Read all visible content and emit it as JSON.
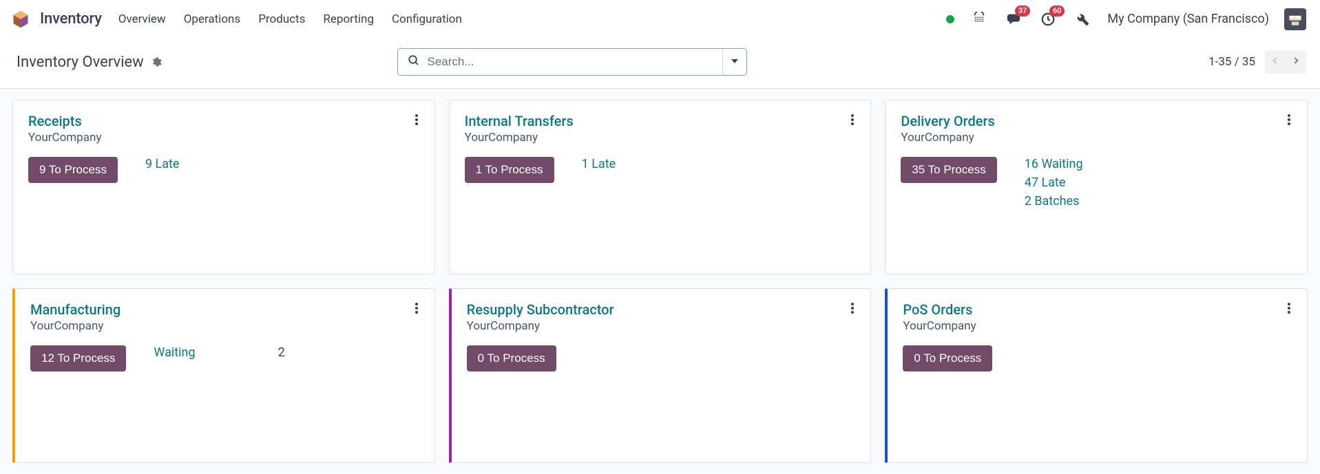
{
  "nav": {
    "app": "Inventory",
    "menu": [
      "Overview",
      "Operations",
      "Products",
      "Reporting",
      "Configuration"
    ],
    "badges": {
      "messages": "37",
      "activities": "60"
    },
    "company": "My Company (San Francisco)"
  },
  "control": {
    "title": "Inventory Overview",
    "search_placeholder": "Search...",
    "pager": "1-35 / 35"
  },
  "cards": [
    {
      "title": "Receipts",
      "subtitle": "YourCompany",
      "process": "9 To Process",
      "border": "",
      "stats": [
        {
          "text": "9 Late"
        }
      ],
      "stats_plain": null
    },
    {
      "title": "Internal Transfers",
      "subtitle": "YourCompany",
      "process": "1 To Process",
      "border": "",
      "stats": [
        {
          "text": "1 Late"
        }
      ],
      "stats_plain": null
    },
    {
      "title": "Delivery Orders",
      "subtitle": "YourCompany",
      "process": "35 To Process",
      "border": "",
      "stats": [
        {
          "text": "16 Waiting"
        },
        {
          "text": "47 Late"
        },
        {
          "text": "2 Batches"
        }
      ],
      "stats_plain": null
    },
    {
      "title": "Manufacturing",
      "subtitle": "YourCompany",
      "process": "12 To Process",
      "border": "border-left-orange",
      "stats": null,
      "stats_plain": {
        "label": "Waiting",
        "value": "2"
      }
    },
    {
      "title": "Resupply Subcontractor",
      "subtitle": "YourCompany",
      "process": "0 To Process",
      "border": "border-left-purple",
      "stats": null,
      "stats_plain": null
    },
    {
      "title": "PoS Orders",
      "subtitle": "YourCompany",
      "process": "0 To Process",
      "border": "border-left-blue",
      "stats": null,
      "stats_plain": null
    }
  ]
}
